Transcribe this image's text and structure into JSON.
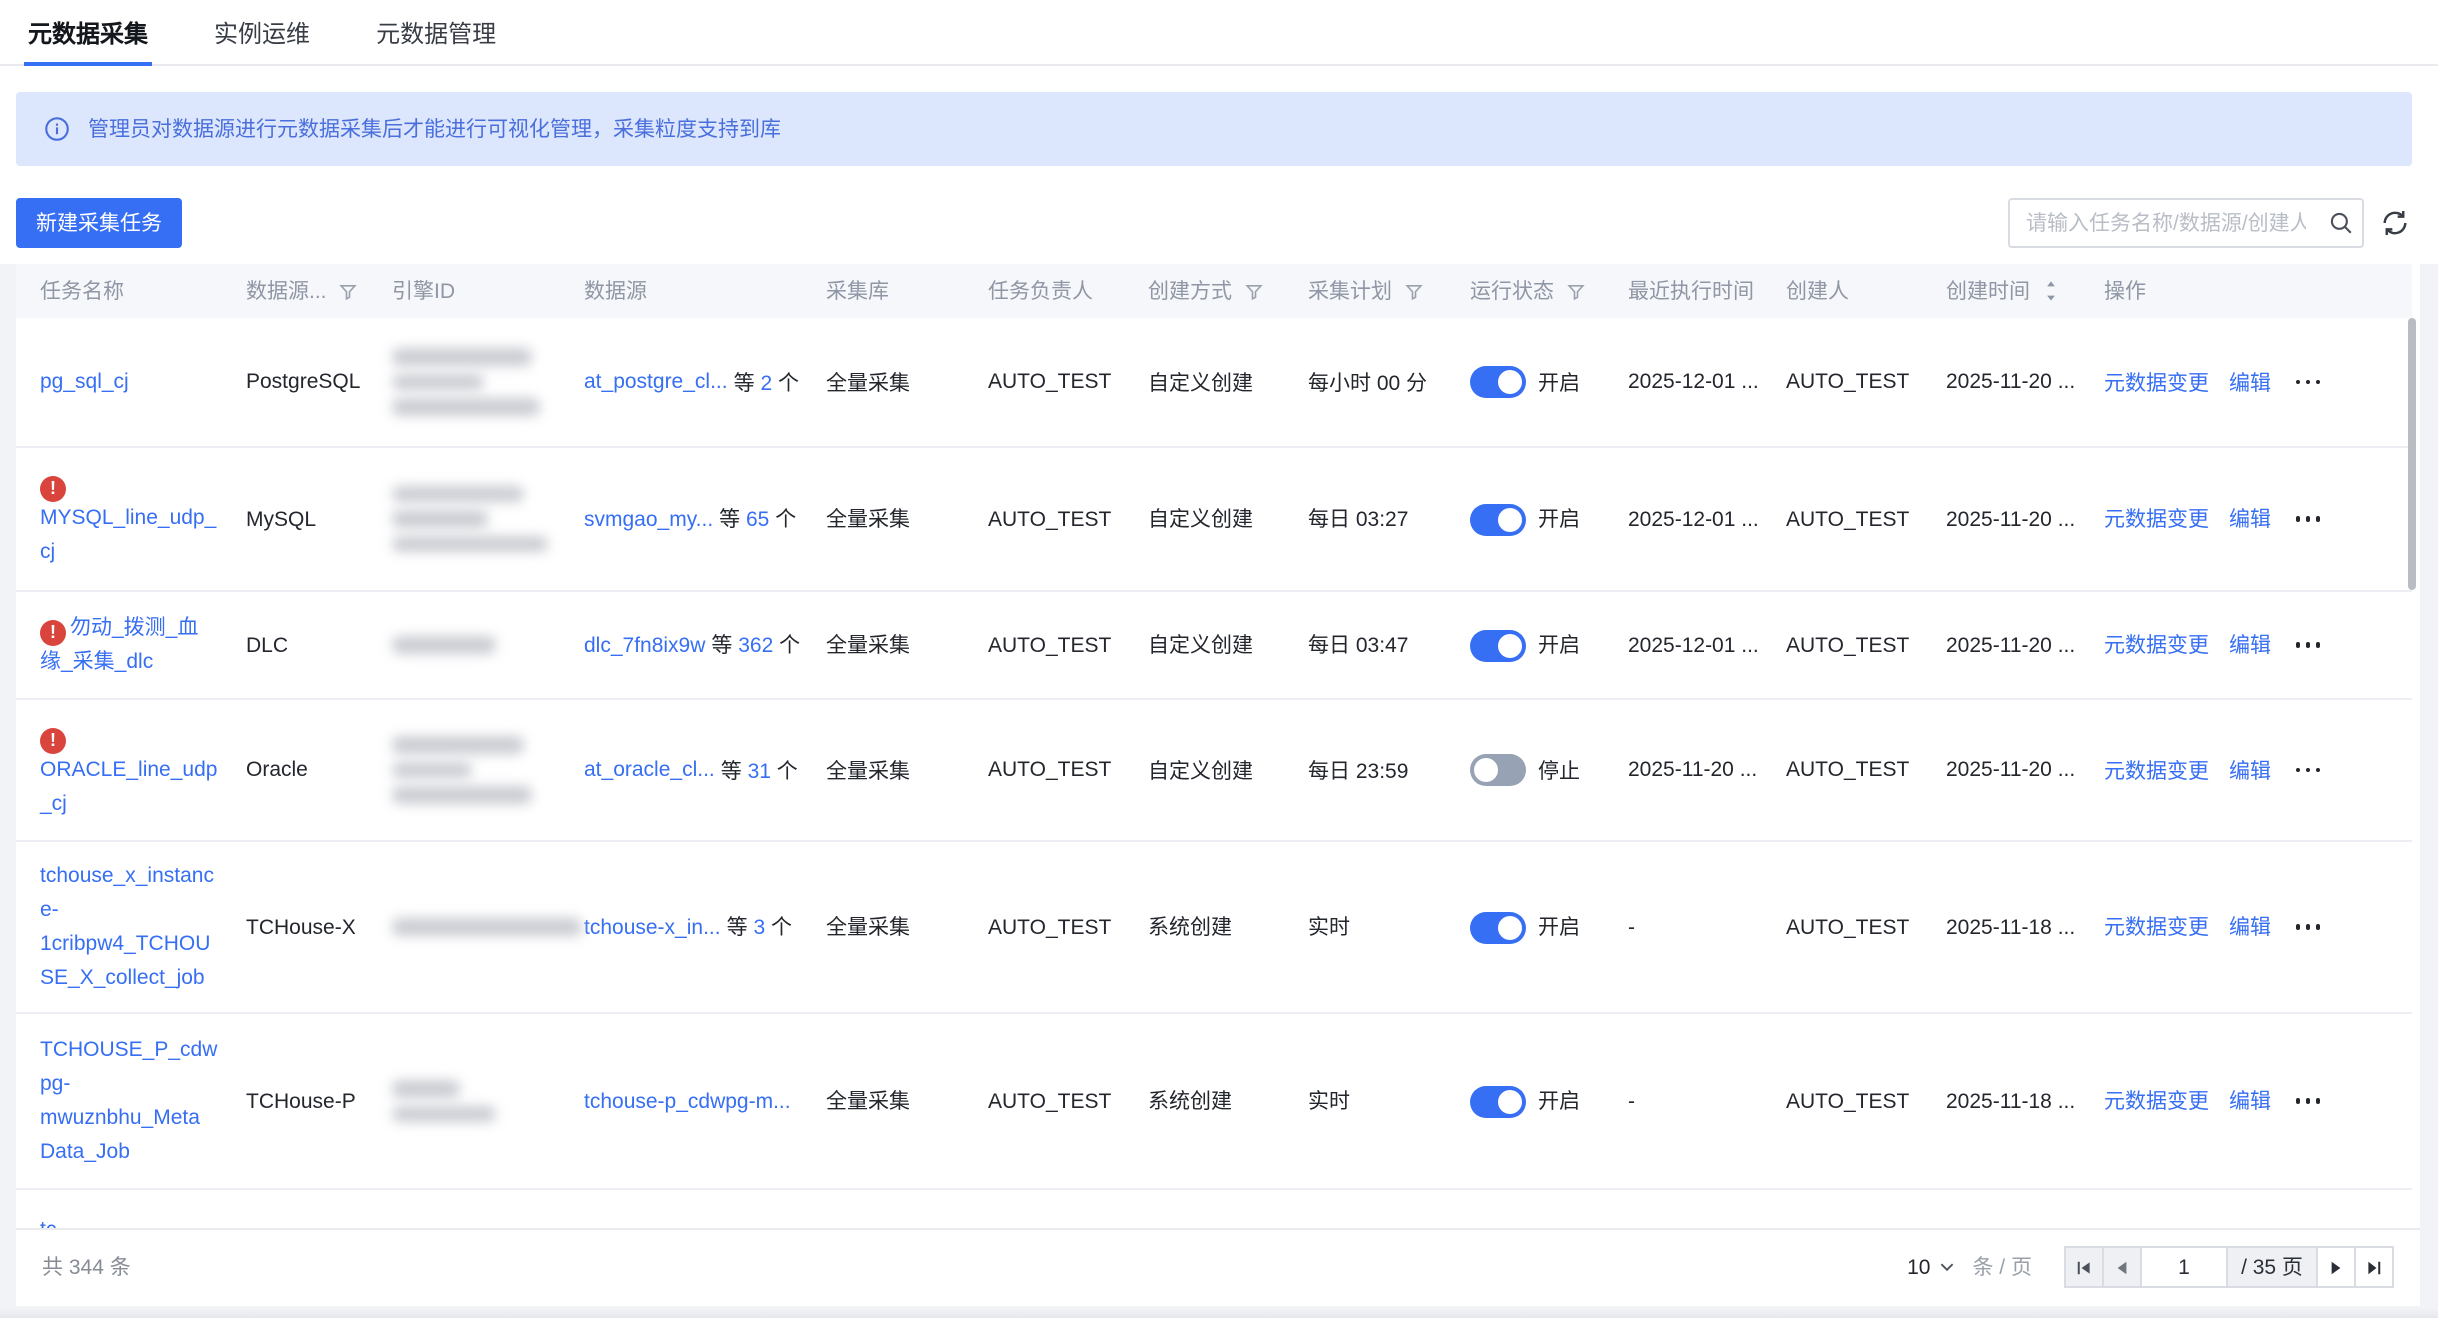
{
  "tabs": [
    {
      "label": "元数据采集",
      "active": true
    },
    {
      "label": "实例运维",
      "active": false
    },
    {
      "label": "元数据管理",
      "active": false
    }
  ],
  "banner": {
    "icon": "info-icon",
    "text": "管理员对数据源进行元数据采集后才能进行可视化管理，采集粒度支持到库"
  },
  "toolbar": {
    "new_button": "新建采集任务",
    "search_placeholder": "请输入任务名称/数据源/创建人"
  },
  "table": {
    "columns": [
      {
        "label": "任务名称"
      },
      {
        "label": "数据源...",
        "filter": true
      },
      {
        "label": "引擎ID"
      },
      {
        "label": "数据源"
      },
      {
        "label": "采集库"
      },
      {
        "label": "任务负责人"
      },
      {
        "label": "创建方式",
        "filter": true
      },
      {
        "label": "采集计划",
        "filter": true
      },
      {
        "label": "运行状态",
        "filter": true
      },
      {
        "label": "最近执行时间"
      },
      {
        "label": "创建人"
      },
      {
        "label": "创建时间",
        "sort": true
      },
      {
        "label": "操作"
      }
    ],
    "rows": [
      {
        "name": "pg_sql_cj",
        "alert": false,
        "type": "PostgreSQL",
        "datasource": {
          "link": "at_postgre_cl...",
          "prefix": "等",
          "count": "2",
          "suffix": "个"
        },
        "library": "全量采集",
        "owner": "AUTO_TEST",
        "create_mode": "自定义创建",
        "schedule": "每小时 00 分",
        "status_on": true,
        "status_label": "开启",
        "last_run": "2025-12-01 ...",
        "creator": "AUTO_TEST",
        "created": "2025-11-20 ...",
        "actions": [
          "元数据变更",
          "编辑"
        ]
      },
      {
        "name": "MYSQL_line_udp_\ncj",
        "alert": true,
        "type": "MySQL",
        "datasource": {
          "link": "svmgao_my...",
          "prefix": "等",
          "count": "65",
          "suffix": "个"
        },
        "library": "全量采集",
        "owner": "AUTO_TEST",
        "create_mode": "自定义创建",
        "schedule": "每日 03:27",
        "status_on": true,
        "status_label": "开启",
        "last_run": "2025-12-01 ...",
        "creator": "AUTO_TEST",
        "created": "2025-11-20 ...",
        "actions": [
          "元数据变更",
          "编辑"
        ]
      },
      {
        "name": "勿动_拨测_血\n缘_采集_dlc",
        "alert": true,
        "type": "DLC",
        "datasource": {
          "link": "dlc_7fn8ix9w",
          "prefix": "等",
          "count": "362",
          "suffix": "个"
        },
        "library": "全量采集",
        "owner": "AUTO_TEST",
        "create_mode": "自定义创建",
        "schedule": "每日 03:47",
        "status_on": true,
        "status_label": "开启",
        "last_run": "2025-12-01 ...",
        "creator": "AUTO_TEST",
        "created": "2025-11-20 ...",
        "actions": [
          "元数据变更",
          "编辑"
        ]
      },
      {
        "name": "ORACLE_line_udp\n_cj",
        "alert": true,
        "type": "Oracle",
        "datasource": {
          "link": "at_oracle_cl...",
          "prefix": "等",
          "count": "31",
          "suffix": "个"
        },
        "library": "全量采集",
        "owner": "AUTO_TEST",
        "create_mode": "自定义创建",
        "schedule": "每日 23:59",
        "status_on": false,
        "status_label": "停止",
        "last_run": "2025-11-20 ...",
        "creator": "AUTO_TEST",
        "created": "2025-11-20 ...",
        "actions": [
          "元数据变更",
          "编辑"
        ]
      },
      {
        "name": "tchouse_x_instanc\ne-\n1cribpw4_TCHOU\nSE_X_collect_job",
        "alert": false,
        "type": "TCHouse-X",
        "datasource": {
          "link": "tchouse-x_in...",
          "prefix": "等",
          "count": "3",
          "suffix": "个"
        },
        "library": "全量采集",
        "owner": "AUTO_TEST",
        "create_mode": "系统创建",
        "schedule": "实时",
        "status_on": true,
        "status_label": "开启",
        "last_run": "-",
        "creator": "AUTO_TEST",
        "created": "2025-11-18 ...",
        "actions": [
          "元数据变更",
          "编辑"
        ]
      },
      {
        "name": "TCHOUSE_P_cdw\npg-\nmwuznbhu_Meta\nData_Job",
        "alert": false,
        "type": "TCHouse-P",
        "datasource": {
          "link": "tchouse-p_cdwpg-m...",
          "prefix": "",
          "count": "",
          "suffix": ""
        },
        "library": "全量采集",
        "owner": "AUTO_TEST",
        "create_mode": "系统创建",
        "schedule": "实时",
        "status_on": true,
        "status_label": "开启",
        "last_run": "-",
        "creator": "AUTO_TEST",
        "created": "2025-11-18 ...",
        "actions": [
          "元数据变更",
          "编辑"
        ]
      }
    ],
    "partial_row": {
      "name": "tc..."
    }
  },
  "footer": {
    "total": "共 344 条",
    "page_size": "10",
    "per_page": "条 / 页",
    "page": "1",
    "pages": "/ 35 页"
  }
}
